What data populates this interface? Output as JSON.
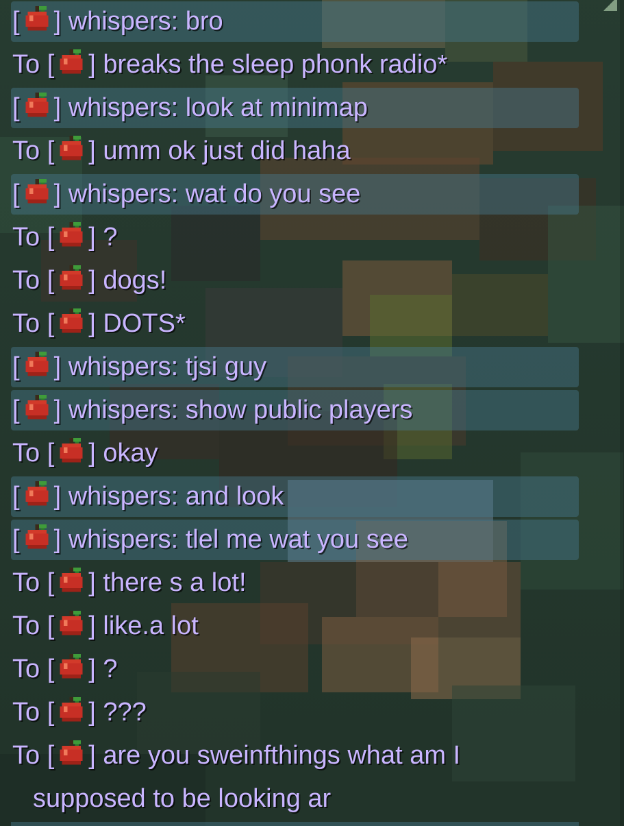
{
  "chat": {
    "messages": [
      {
        "kind": "whisper-in",
        "prefix": "",
        "label": "whispers:",
        "text": "bro"
      },
      {
        "kind": "whisper-out",
        "prefix": "To",
        "label": "",
        "text": "breaks the sleep phonk radio*"
      },
      {
        "kind": "whisper-in",
        "prefix": "",
        "label": "whispers:",
        "text": "look at minimap"
      },
      {
        "kind": "whisper-out",
        "prefix": "To",
        "label": "",
        "text": "umm ok just did haha"
      },
      {
        "kind": "whisper-in",
        "prefix": "",
        "label": "whispers:",
        "text": "wat do you see"
      },
      {
        "kind": "whisper-out",
        "prefix": "To",
        "label": "",
        "text": "?"
      },
      {
        "kind": "whisper-out",
        "prefix": "To",
        "label": "",
        "text": "dogs!"
      },
      {
        "kind": "whisper-out",
        "prefix": "To",
        "label": "",
        "text": "DOTS*"
      },
      {
        "kind": "whisper-in",
        "prefix": "",
        "label": "whispers:",
        "text": "tjsi guy"
      },
      {
        "kind": "whisper-in",
        "prefix": "",
        "label": "whispers:",
        "text": "show public players"
      },
      {
        "kind": "whisper-out",
        "prefix": "To",
        "label": "",
        "text": "okay"
      },
      {
        "kind": "whisper-in",
        "prefix": "",
        "label": "whispers:",
        "text": "and look"
      },
      {
        "kind": "whisper-in",
        "prefix": "",
        "label": "whispers:",
        "text": "tlel me wat you see"
      },
      {
        "kind": "whisper-out",
        "prefix": "To",
        "label": "",
        "text": "there s a lot!"
      },
      {
        "kind": "whisper-out",
        "prefix": "To",
        "label": "",
        "text": "like.a lot"
      },
      {
        "kind": "whisper-out",
        "prefix": "To",
        "label": "",
        "text": "?"
      },
      {
        "kind": "whisper-out",
        "prefix": "To",
        "label": "",
        "text": "???"
      },
      {
        "kind": "whisper-out",
        "prefix": "To",
        "label": "",
        "text": "are you sweinfthings what am I",
        "continuation": "supposed to be looking ar"
      }
    ],
    "bracket_open": "[",
    "bracket_close": "]",
    "sender_icon": "apple-icon"
  },
  "colors": {
    "text": "#c9b5ff",
    "whisper_highlight": "#46788c",
    "background": "#2a4034"
  }
}
